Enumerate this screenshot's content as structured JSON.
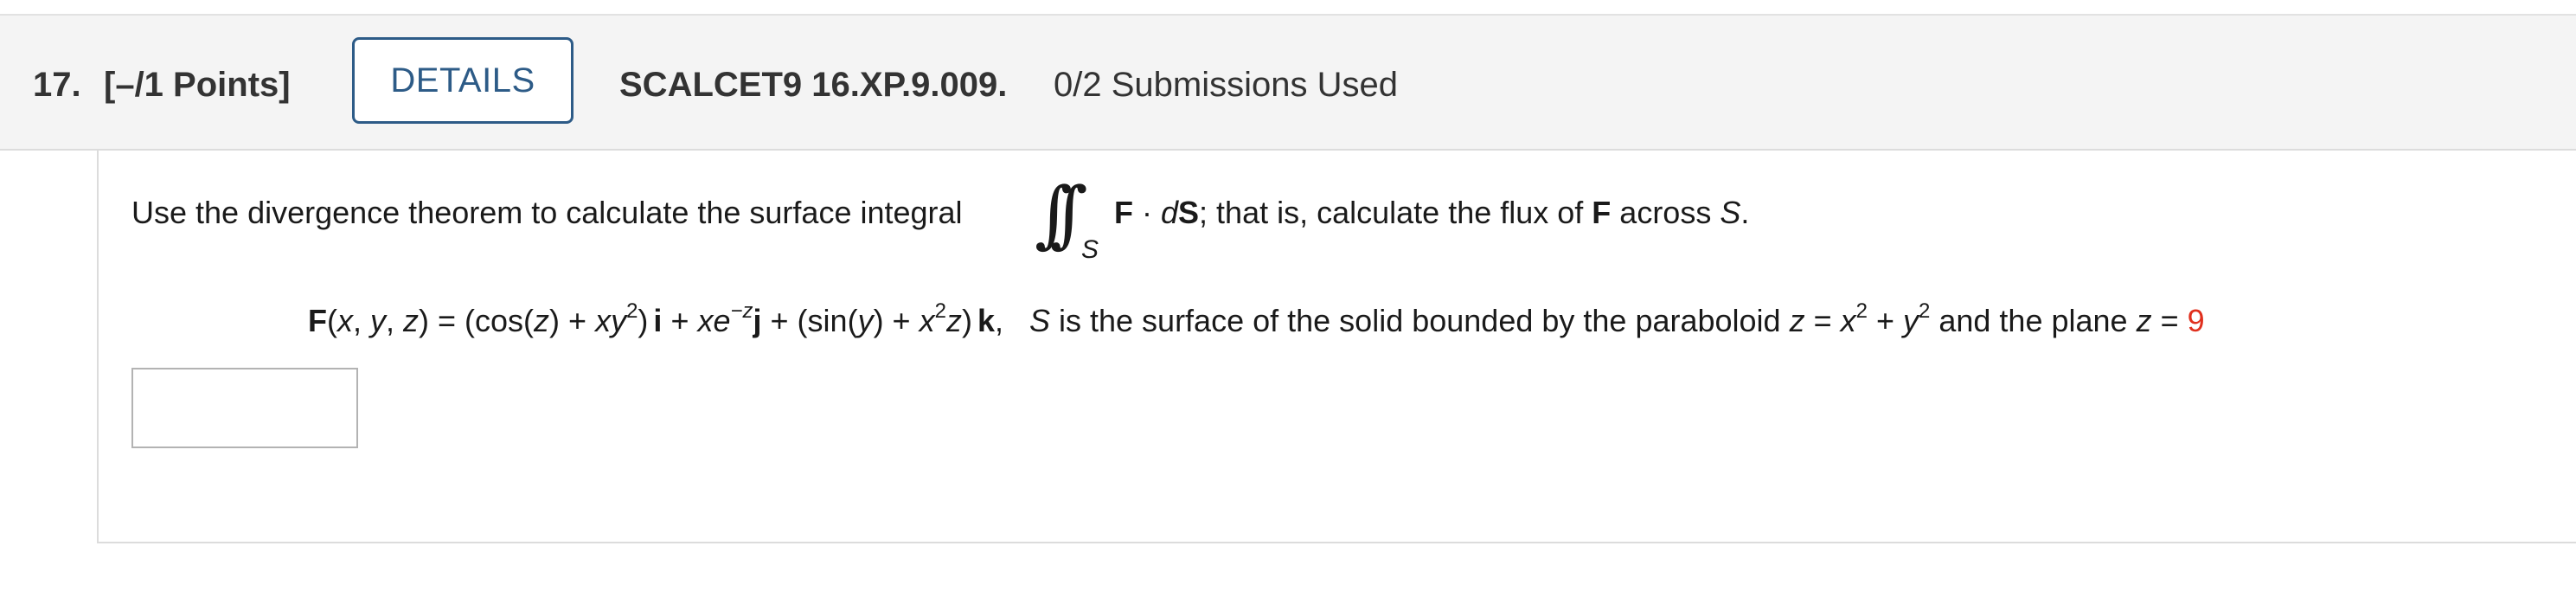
{
  "header": {
    "question_number": "17.",
    "points": "[–/1 Points]",
    "details_label": "DETAILS",
    "problem_id": "SCALCET9 16.XP.9.009.",
    "submissions": "0/2 Submissions Used"
  },
  "problem": {
    "prompt_before": "Use the divergence theorem to calculate the surface integral",
    "integral_symbol": "∫∫",
    "integral_subscript": "S",
    "integrand_F": "F",
    "integrand_dot": " · ",
    "integrand_d": "d",
    "integrand_S": "S",
    "prompt_mid": "; that is, calculate the flux of ",
    "prompt_F": "F",
    "prompt_across": " across ",
    "prompt_S": "S",
    "prompt_end": ".",
    "formula": {
      "F": "F",
      "args_open": "(",
      "x1": "x",
      "c1": ", ",
      "y1": "y",
      "c2": ", ",
      "z1": "z",
      "args_close": ") = (cos(",
      "z2": "z",
      "t1": ") + ",
      "x2": "x",
      "y2": "y",
      "exp2a": "2",
      "t2": ")",
      "i": "i",
      "t3": " + ",
      "x3": "x",
      "e": "e",
      "exp_negz": "−z",
      "j": "j",
      "t4": " + (sin(",
      "y3": "y",
      "t5": ") + ",
      "x4": "x",
      "exp2b": "2",
      "z3": "z",
      "t6": ")",
      "k": "k",
      "t7": ",   ",
      "S": "S",
      "t8": " is the surface of the solid bounded by the paraboloid ",
      "z4": "z",
      "t9": " = ",
      "x5": "x",
      "exp2c": "2",
      "t10": " + ",
      "y4": "y",
      "exp2d": "2",
      "t11": " and the plane ",
      "z5": "z",
      "t12": " = ",
      "plane_value": "9"
    },
    "answer_value": ""
  },
  "colors": {
    "accent": "#2d5b87",
    "highlight": "#e0301e",
    "header_bg": "#f4f4f4"
  }
}
